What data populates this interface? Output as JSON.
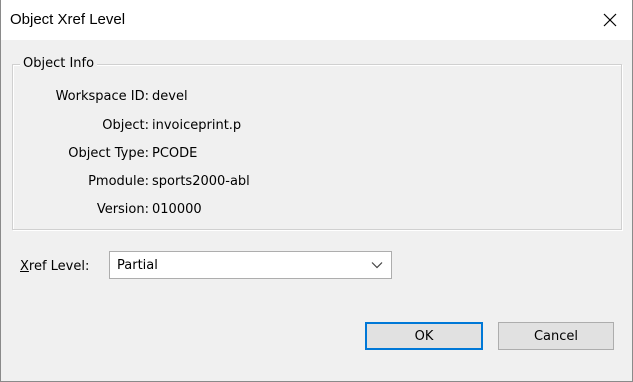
{
  "window": {
    "title": "Object Xref Level",
    "close_icon": "close-icon"
  },
  "object_info": {
    "legend": "Object Info",
    "rows": [
      {
        "label": "Workspace ID:",
        "value": "devel"
      },
      {
        "label": "Object:",
        "value": "invoiceprint.p"
      },
      {
        "label": "Object Type:",
        "value": "PCODE"
      },
      {
        "label": "Pmodule:",
        "value": "sports2000-abl"
      },
      {
        "label": "Version:",
        "value": "010000"
      }
    ]
  },
  "xref_level": {
    "label_prefix": "X",
    "label_rest": "ref Level:",
    "selected": "Partial",
    "arrow_icon": "chevron-down-icon"
  },
  "buttons": {
    "ok": "OK",
    "cancel": "Cancel"
  },
  "colors": {
    "dialog_bg": "#f0f0f0",
    "default_button_border": "#0078d7"
  }
}
